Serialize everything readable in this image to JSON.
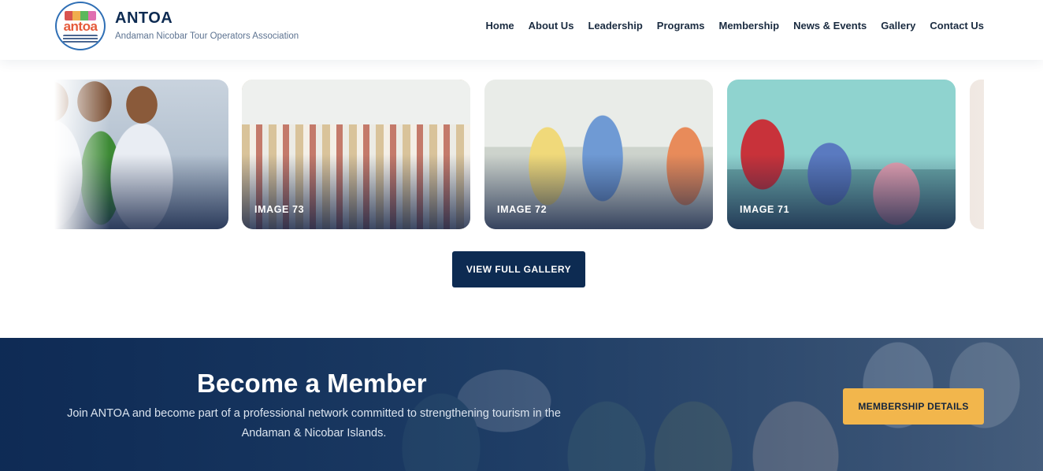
{
  "header": {
    "logo_text": "antoa",
    "brand_title": "ANTOA",
    "brand_subtitle": "Andaman Nicobar Tour Operators Association"
  },
  "nav": {
    "items": [
      {
        "label": "Home"
      },
      {
        "label": "About Us"
      },
      {
        "label": "Leadership"
      },
      {
        "label": "Programs"
      },
      {
        "label": "Membership"
      },
      {
        "label": "News & Events"
      },
      {
        "label": "Gallery"
      },
      {
        "label": "Contact Us"
      }
    ]
  },
  "gallery": {
    "cards": [
      {
        "caption": ""
      },
      {
        "caption": "IMAGE 73"
      },
      {
        "caption": "IMAGE 72"
      },
      {
        "caption": "IMAGE 71"
      },
      {
        "caption": ""
      }
    ],
    "button_label": "VIEW FULL GALLERY"
  },
  "member": {
    "title": "Become a Member",
    "description": "Join ANTOA and become part of a professional network committed to strengthening tourism in the Andaman & Nicobar Islands.",
    "button_label": "MEMBERSHIP DETAILS"
  },
  "colors": {
    "primary_navy": "#0d2b52",
    "accent_yellow": "#f2b64c"
  }
}
